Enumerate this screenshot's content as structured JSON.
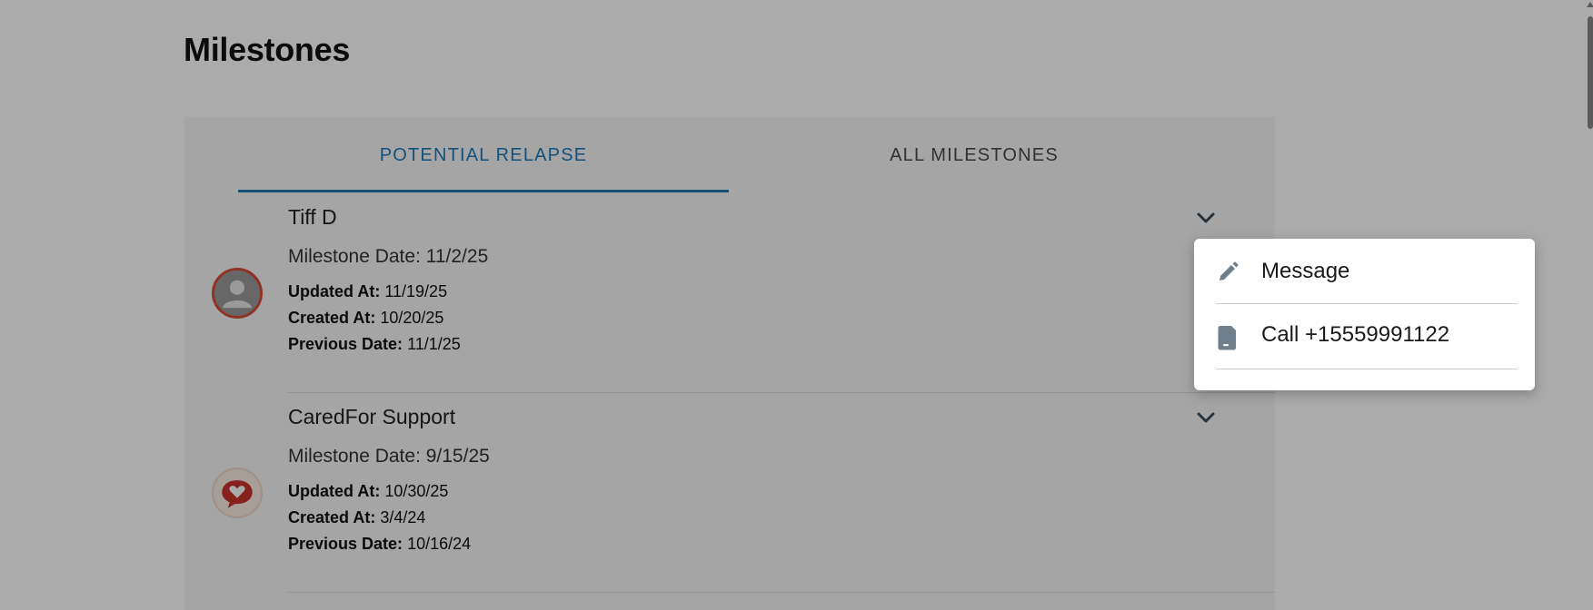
{
  "page": {
    "title": "Milestones"
  },
  "tabs": [
    {
      "label": "POTENTIAL RELAPSE",
      "active": true
    },
    {
      "label": "ALL MILESTONES",
      "active": false
    }
  ],
  "entries": [
    {
      "name": "Tiff D",
      "milestone_date": "Milestone Date: 11/2/25",
      "updated_label": "Updated At:",
      "updated_value": "11/19/25",
      "created_label": "Created At:",
      "created_value": "10/20/25",
      "previous_label": "Previous Date:",
      "previous_value": "11/1/25",
      "avatar": "user-placeholder-icon"
    },
    {
      "name": "CaredFor Support",
      "milestone_date": "Milestone Date: 9/15/25",
      "updated_label": "Updated At:",
      "updated_value": "10/30/25",
      "created_label": "Created At:",
      "created_value": "3/4/24",
      "previous_label": "Previous Date:",
      "previous_value": "10/16/24",
      "avatar": "heart-chat-icon"
    }
  ],
  "menu": {
    "items": [
      {
        "label": "Message",
        "icon": "pencil-icon"
      },
      {
        "label": "Call +15559991122",
        "icon": "phone-icon"
      }
    ]
  },
  "colors": {
    "accent": "#1d7ab8",
    "avatar_ring": "#d64e38",
    "brand_heart": "#c8322d"
  }
}
